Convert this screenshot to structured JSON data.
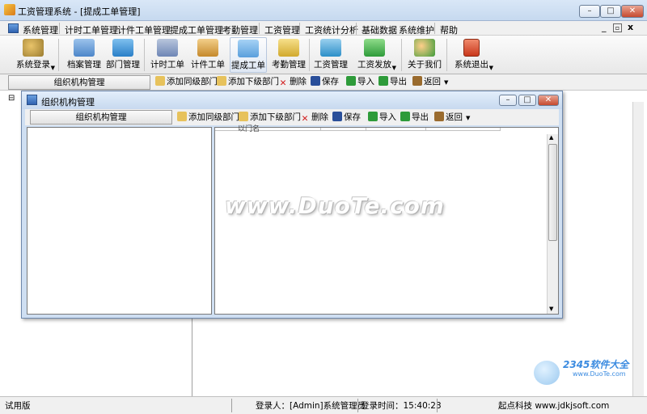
{
  "window": {
    "title": "工资管理系统 - [提成工单管理]",
    "controls": [
      "–",
      "□",
      "✕"
    ]
  },
  "menu": {
    "items": [
      "系统管理",
      "计时工单管理",
      "计件工单管理",
      "提成工单管理",
      "考勤管理",
      "工资管理",
      "工资统计分析",
      "基础数据",
      "系统维护",
      "帮助"
    ],
    "mdi_controls": [
      "_",
      "▫",
      "x"
    ]
  },
  "toolbar": {
    "buttons": [
      {
        "label": "系统登录",
        "icon": "keys-icon"
      },
      {
        "label": "档案管理",
        "icon": "folder-icon"
      },
      {
        "label": "部门管理",
        "icon": "department-icon"
      },
      {
        "label": "计时工单",
        "icon": "clock-sheet-icon"
      },
      {
        "label": "计件工单",
        "icon": "piece-sheet-icon"
      },
      {
        "label": "提成工单",
        "icon": "commission-icon"
      },
      {
        "label": "考勤管理",
        "icon": "attendance-icon"
      },
      {
        "label": "工资管理",
        "icon": "salary-icon"
      },
      {
        "label": "工资发放",
        "icon": "payout-icon"
      },
      {
        "label": "关于我们",
        "icon": "people-icon"
      },
      {
        "label": "系统退出",
        "icon": "exit-icon"
      }
    ]
  },
  "subbar": {
    "panel_title": "组织机构管理",
    "actions": [
      "添加同级部门",
      "添加下级部门",
      "删除",
      "保存",
      "导入",
      "导出",
      "返回"
    ]
  },
  "tree": {
    "root_toggle": "⊟"
  },
  "child_window": {
    "title": "组织机构管理",
    "panel_title": "组织机构管理",
    "actions": [
      "添加同级部门",
      "添加下级部门",
      "删除",
      "保存",
      "导入",
      "导出",
      "返回"
    ],
    "grid_header_fragment": "以门名"
  },
  "watermark": {
    "text": "www.DuoTe.com",
    "corner_brand": "2345软件大全",
    "corner_url": "www.DuoTe.com"
  },
  "statusbar": {
    "mode": "试用版",
    "user": "登录人：[Admin]系统管理员",
    "login_time": "登录时间：15:40:23",
    "company": "起点科技  www.jdkjsoft.com"
  },
  "colors": {
    "titlebar": "#c6d9ef",
    "close_button": "#c64a2f",
    "delete_icon": "#d21e1e",
    "export_import_green": "#2e9b3a"
  }
}
